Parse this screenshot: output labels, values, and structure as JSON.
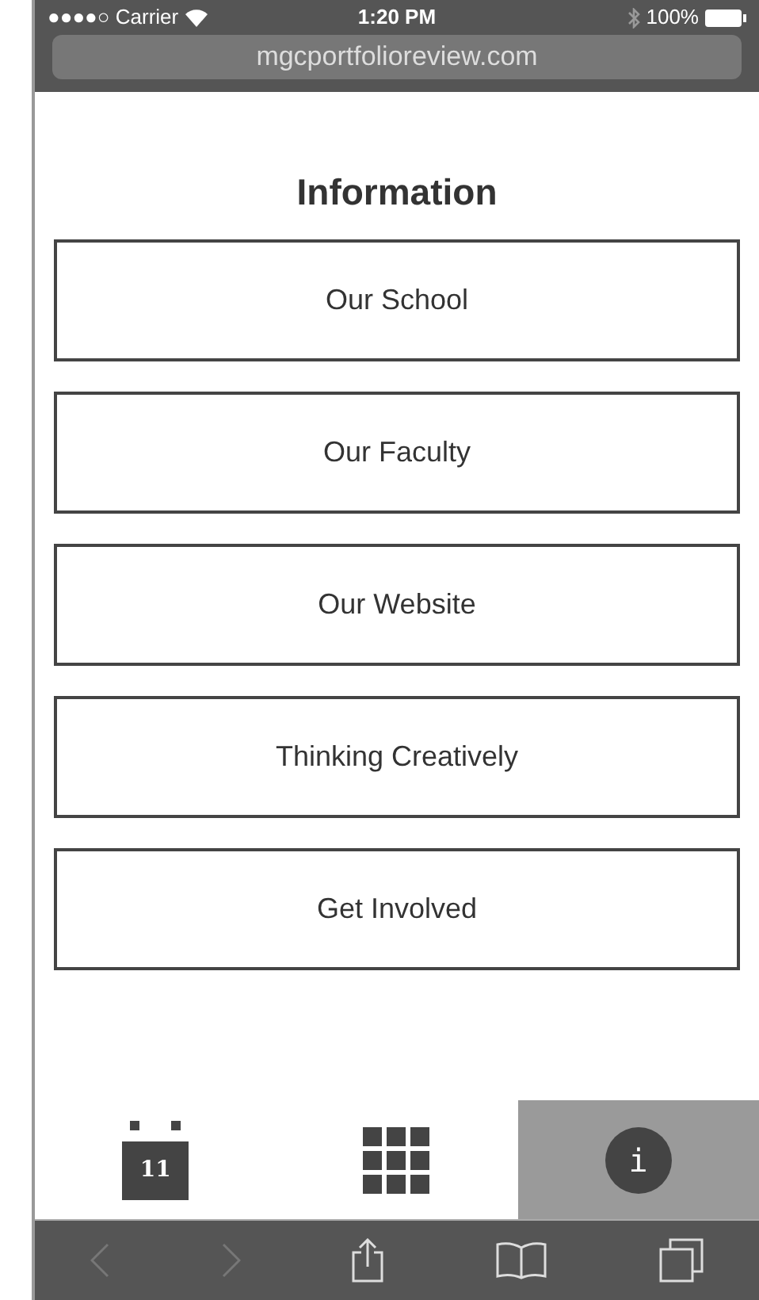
{
  "status_bar": {
    "carrier": "●●●●○ Carrier",
    "time": "1:20 PM",
    "battery": "100%"
  },
  "address_bar": {
    "url": "mgcportfolioreview.com"
  },
  "title": "Information",
  "links": [
    {
      "label": "Our School"
    },
    {
      "label": "Our Faculty"
    },
    {
      "label": "Our Website"
    },
    {
      "label": "Thinking Creatively"
    },
    {
      "label": "Get Involved"
    }
  ],
  "tabs": [
    {
      "kind": "calendar",
      "text": "11",
      "selected": false
    },
    {
      "kind": "grid",
      "selected": false
    },
    {
      "kind": "info",
      "text": "i",
      "selected": true
    }
  ],
  "toolbar": {
    "back_disabled": true,
    "forward_disabled": true
  }
}
